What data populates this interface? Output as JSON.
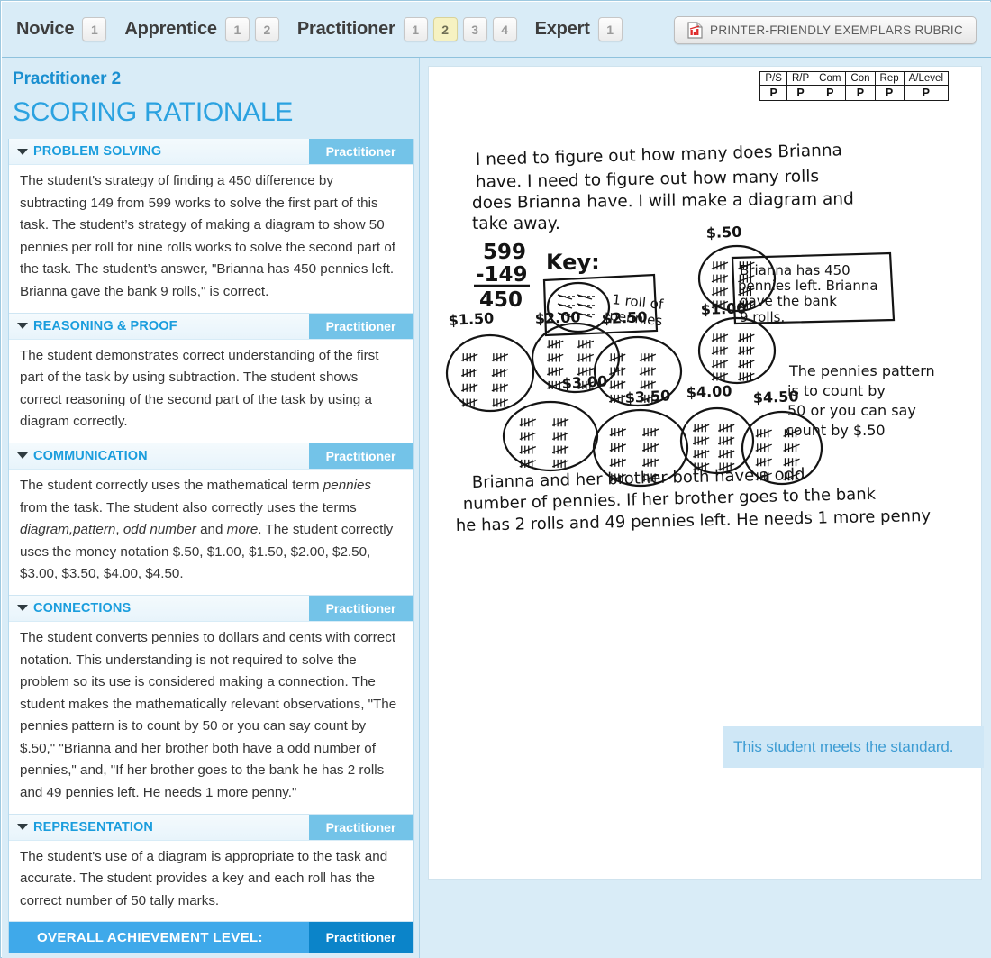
{
  "tabbar": {
    "groups": [
      {
        "name": "Novice",
        "buttons": [
          {
            "label": "1",
            "selected": false
          }
        ]
      },
      {
        "name": "Apprentice",
        "buttons": [
          {
            "label": "1",
            "selected": false
          },
          {
            "label": "2",
            "selected": false
          }
        ]
      },
      {
        "name": "Practitioner",
        "buttons": [
          {
            "label": "1",
            "selected": false
          },
          {
            "label": "2",
            "selected": true
          },
          {
            "label": "3",
            "selected": false
          },
          {
            "label": "4",
            "selected": false
          }
        ]
      },
      {
        "name": "Expert",
        "buttons": [
          {
            "label": "1",
            "selected": false
          }
        ]
      }
    ],
    "print_button": {
      "label": "PRINTER-FRIENDLY EXEMPLARS RUBRIC",
      "icon": "pdf-document-icon"
    }
  },
  "left_panel": {
    "subtitle": "Practitioner 2",
    "title": "SCORING RATIONALE",
    "sections": [
      {
        "title": "PROBLEM SOLVING",
        "badge": "Practitioner",
        "body_html": "The student's strategy of finding a 450 difference by subtracting 149 from 599 works to solve the first part of this task. The student’s strategy of making a diagram to show 50 pennies per roll for nine rolls works to solve the second part of the task. The student’s answer, \"Brianna has 450 pennies left. Brianna gave the bank 9 rolls,\" is correct."
      },
      {
        "title": "REASONING & PROOF",
        "badge": "Practitioner",
        "body_html": "The student demonstrates correct understanding of the first part of the task by using subtraction. The student shows correct reasoning of the second part of the task by using a diagram correctly."
      },
      {
        "title": "COMMUNICATION",
        "badge": "Practitioner",
        "body_html": "The student correctly uses the mathematical term <em>pennies</em> from the task. The student also correctly uses the terms <em>diagram,pattern</em>, <em>odd number</em> and <em>more</em>. The student correctly uses the money notation $.50, $1.00, $1.50, $2.00, $2.50, $3.00, $3.50, $4.00, $4.50."
      },
      {
        "title": "CONNECTIONS",
        "badge": "Practitioner",
        "body_html": "The student converts pennies to dollars and cents with correct notation. This understanding is not required to solve the problem so its use is considered making a connection. The student makes the mathematically relevant observations, \"The pennies pattern is to count by 50 or you can say count by $.50,\"  \"Brianna and her brother both have a odd number of pennies,\" and, \"If her brother goes to the bank he has 2 rolls and 49 pennies left. He needs 1 more penny.\""
      },
      {
        "title": "REPRESENTATION",
        "badge": "Practitioner",
        "body_html": "The student's use of a diagram is appropriate to the task and accurate. The student provides a key and each roll has the correct number of 50 tally marks."
      }
    ],
    "overall": {
      "label": "OVERALL ACHIEVEMENT LEVEL:",
      "badge": "Practitioner"
    }
  },
  "right_panel": {
    "score_table": {
      "headers": [
        "P/S",
        "R/P",
        "Com",
        "Con",
        "Rep",
        "A/Level"
      ],
      "values": [
        "P",
        "P",
        "P",
        "P",
        "P",
        "P"
      ]
    },
    "student_work": {
      "intro_lines": [
        "I need to figure out how many does Brianna",
        "have. I need to figure out how many rolls",
        "does Brianna have. I will make a diagram and",
        "take away."
      ],
      "subtraction": [
        "599",
        "-149",
        "450"
      ],
      "key_label": "Key:",
      "key_caption": "1 roll of pennies",
      "roll_labels": [
        "$.50",
        "$1.00",
        "$1.50",
        "$2.00",
        "$2.50",
        "$3.00",
        "$3.50",
        "$4.00",
        "$4.50"
      ],
      "answer_box": "Brianna has 450 pennies left. Brianna gave the bank 9 rolls.",
      "pattern_note": "The pennies pattern is to count by 50 or you can say count by $.50",
      "bottom_note": "Brianna and her brother both have a odd number of pennies. If her brother goes to the bank he has 2 rolls and 49 pennies left. He needs 1 more penny."
    },
    "standard_banner": "This student meets the standard."
  },
  "colors": {
    "panel_bg": "#d9ecf7",
    "accent_blue": "#2ba2e0",
    "badge_blue": "#73c3e8",
    "overall_blue": "#3fa9ea",
    "overall_badge_blue": "#0b84c9",
    "selected_tab": "#f6f2c2"
  }
}
